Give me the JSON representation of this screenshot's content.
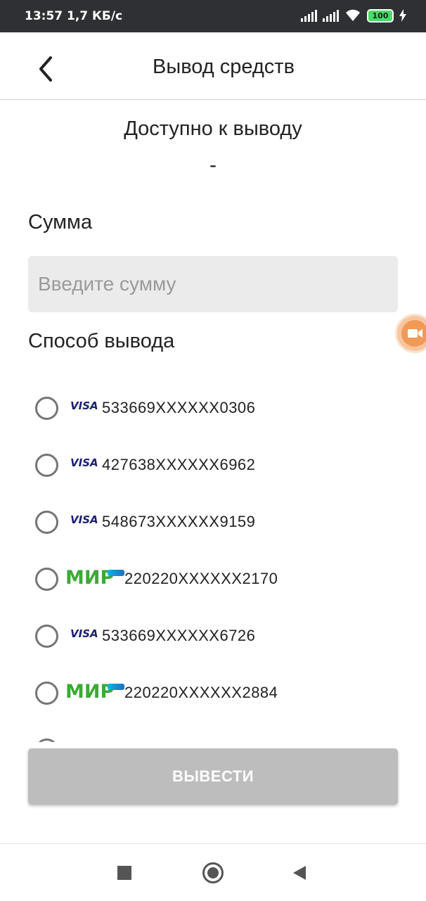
{
  "status_bar": {
    "time": "13:57",
    "speed": "1,7 КБ/с",
    "battery": "100"
  },
  "header": {
    "title": "Вывод средств"
  },
  "balance": {
    "label": "Доступно к выводу",
    "value": "-"
  },
  "amount": {
    "label": "Сумма",
    "placeholder": "Введите сумму",
    "value": ""
  },
  "withdraw_method": {
    "label": "Способ вывода",
    "options": [
      {
        "brand": "VISA",
        "number": "533669XXXXXX0306"
      },
      {
        "brand": "VISA",
        "number": "427638XXXXXX6962"
      },
      {
        "brand": "VISA",
        "number": "548673XXXXXX9159"
      },
      {
        "brand": "МИР",
        "number": "220220XXXXXX2170"
      },
      {
        "brand": "VISA",
        "number": "533669XXXXXX6726"
      },
      {
        "brand": "МИР",
        "number": "220220XXXXXX2884"
      }
    ]
  },
  "submit": {
    "label": "ВЫВЕСТИ"
  },
  "colors": {
    "visa": "#1a1f71",
    "mir": "#3aaa35",
    "button_disabled": "#bdbdbd",
    "input_bg": "#ebebeb",
    "status_bar_bg": "#2f3033"
  }
}
